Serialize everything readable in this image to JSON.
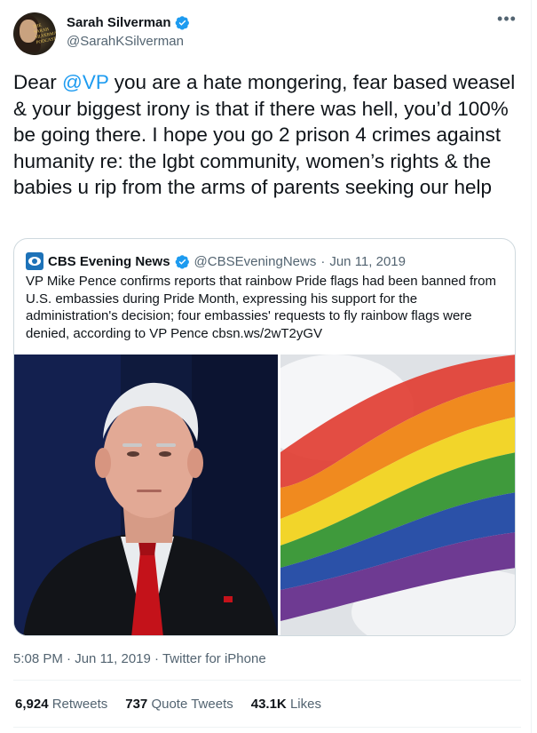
{
  "author": {
    "display_name": "Sarah Silverman",
    "handle": "@SarahKSilverman",
    "avatar_text": "THE SARAH SILVERMAN PODCAST",
    "verified": true
  },
  "tweet": {
    "text_prefix": "Dear ",
    "mention": "@VP",
    "text_body": " you are a hate mongering, fear based weasel & your biggest irony is that if there was hell, you’d 100% be  going there. I hope you go 2 prison 4 crimes against humanity re: the lgbt community, women’s rights & the babies u rip from the arms of parents seeking our help",
    "time": "5:08 PM",
    "date": "Jun 11, 2019",
    "source": "Twitter for iPhone",
    "more_icon": "more-horizontal-icon"
  },
  "quoted": {
    "name": "CBS Evening News",
    "handle": "@CBSEveningNews",
    "date": "Jun 11, 2019",
    "text": "VP Mike Pence confirms reports that rainbow Pride flags had been banned from U.S. embassies during Pride Month, expressing his support for the administration's decision; four embassies' requests to fly rainbow flags were denied, according to VP Pence cbsn.ws/2wT2yGV",
    "verified": true
  },
  "stats": {
    "retweets_count": "6,924",
    "retweets_label": "Retweets",
    "quotes_count": "737",
    "quotes_label": "Quote Tweets",
    "likes_count": "43.1K",
    "likes_label": "Likes"
  },
  "colors": {
    "accent": "#1d9bf0",
    "text": "#0f1419",
    "muted": "#536471",
    "border": "#cfd9de"
  }
}
